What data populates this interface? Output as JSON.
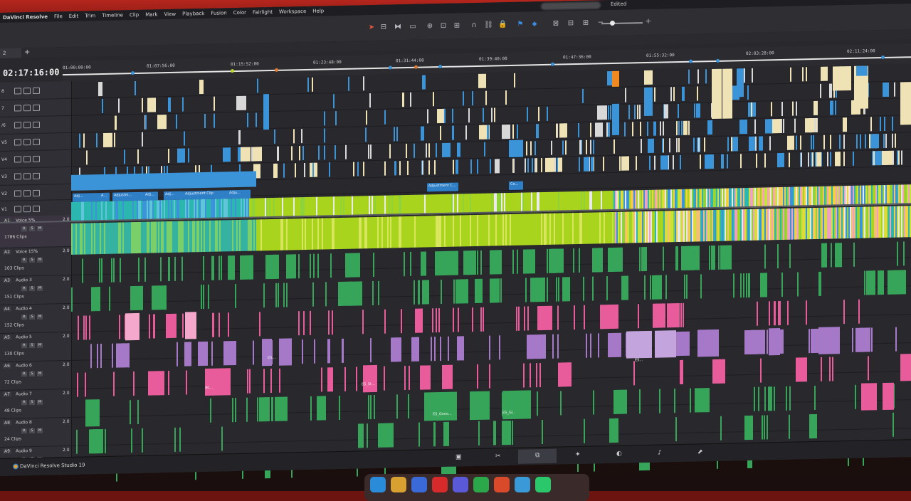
{
  "app": {
    "name": "DaVinci Resolve",
    "status_label": "Edited",
    "footer_label": "DaVinci Resolve Studio 19"
  },
  "menu": [
    "DaVinci Resolve",
    "File",
    "Edit",
    "Trim",
    "Timeline",
    "Clip",
    "Mark",
    "View",
    "Playback",
    "Fusion",
    "Color",
    "Fairlight",
    "Workspace",
    "Help"
  ],
  "toolbar_icons": [
    "pointer-tool-icon",
    "trim-edit-icon",
    "dynamic-trim-icon",
    "blade-icon",
    "insert-clip-icon",
    "overwrite-clip-icon",
    "replace-clip-icon",
    "snapping-icon",
    "linked-selection-icon",
    "position-lock-icon",
    "flag-icon",
    "marker-icon",
    "zoom-full-icon",
    "zoom-detail-icon",
    "zoom-custom-icon",
    "zoom-out-icon",
    "zoom-in-icon"
  ],
  "timeline": {
    "tab_label": "2",
    "add_tab": "+",
    "timecode": "02:17:16:00",
    "ruler_labels": [
      "01:00:00:00",
      "01:07:56:00",
      "01:15:52:00",
      "01:23:48:00",
      "01:31:44:00",
      "01:39:40:00",
      "01:47:36:00",
      "01:55:32:00",
      "02:03:28:00",
      "02:11:24:00"
    ]
  },
  "video_tracks": [
    {
      "id": "V8",
      "label": "8"
    },
    {
      "id": "V7",
      "label": "7"
    },
    {
      "id": "V6",
      "label": "/6"
    },
    {
      "id": "V5",
      "label": "V5"
    },
    {
      "id": "V4",
      "label": "V4"
    },
    {
      "id": "V3",
      "label": "V3"
    },
    {
      "id": "V2",
      "label": "V2"
    },
    {
      "id": "V1",
      "label": "V1"
    }
  ],
  "audio_tracks": [
    {
      "id": "A1",
      "name": "Voice 5%",
      "level": "2.0",
      "clips": "1786 Clips"
    },
    {
      "id": "A2",
      "name": "Voice 15%",
      "level": "2.0",
      "clips": "103 Clips"
    },
    {
      "id": "A3",
      "name": "Audio 3",
      "level": "2.0",
      "clips": "151 Clips"
    },
    {
      "id": "A4",
      "name": "Audio 4",
      "level": "2.0",
      "clips": "152 Clips"
    },
    {
      "id": "A5",
      "name": "Audio 5",
      "level": "2.0",
      "clips": "130 Clips"
    },
    {
      "id": "A6",
      "name": "Audio 6",
      "level": "2.0",
      "clips": "72 Clips"
    },
    {
      "id": "A7",
      "name": "Audio 7",
      "level": "2.0",
      "clips": "48 Clips"
    },
    {
      "id": "A8",
      "name": "Audio 8",
      "level": "2.0",
      "clips": "24 Clips"
    },
    {
      "id": "A9",
      "name": "Audio 9",
      "level": "2.0",
      "clips": ""
    }
  ],
  "audio_controls": {
    "r": "R",
    "s": "S",
    "m": "M"
  },
  "adjustment_clips": [
    "Adj...",
    "A...",
    "Adjustm...",
    "Adj...",
    "Adjustment Clip",
    "Adju...",
    "Adjustment C...",
    "Ce..."
  ],
  "audio_clip_labels": [
    "ES_Gooo...",
    "ES_Gl..",
    "ES_St...",
    "ES...",
    "ES...",
    "do..."
  ],
  "colors": {
    "video_blue": "#3b93d8",
    "cream": "#efe3b5",
    "lime": "#a8d41e",
    "teal": "#2bb7b0",
    "audio_green": "#36a55a",
    "pink": "#e85c9c",
    "lavender": "#a678c8",
    "orange": "#f08a20",
    "panel": "#28282d"
  },
  "page_icons": [
    "media-page-icon",
    "cut-page-icon",
    "edit-page-icon",
    "fusion-page-icon",
    "color-page-icon",
    "fairlight-page-icon",
    "deliver-page-icon"
  ]
}
